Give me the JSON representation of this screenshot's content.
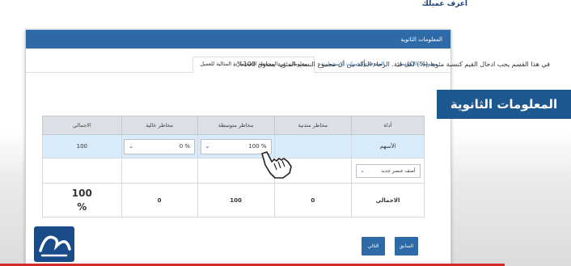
{
  "header": {
    "brand_link": "اعرف عميلك"
  },
  "panel": {
    "title": "المعلومات الثانوية",
    "tabs": [
      {
        "label": "معلومات الاستثمار",
        "active": false
      },
      {
        "label": "المعرفة والخبرات الاستثمارية",
        "active": false
      },
      {
        "label": "معلومات عن المحفظة الاستثمارية المثالية للعميل",
        "active": true
      }
    ],
    "instruction": "في هذا القسم يجب ادخال القيم كنسبة مئوية (%) لكل فئة. الرجاء التأكد من أن مجموع النسب المئوية يساوي 100% ."
  },
  "table": {
    "headers": [
      "أداة",
      "مخاطر متدنية",
      "مخاطر متوسطة",
      "مخاطر عالية",
      "الاجمالي"
    ],
    "stock_row": {
      "label": "الأسهم",
      "low": "",
      "medium": "100 %",
      "high": "0 %",
      "total": "100"
    },
    "add_row": {
      "select_placeholder": "أضف عنصر جديد"
    },
    "total_row": {
      "label": "الاجمالي",
      "low": "0",
      "medium": "100",
      "high": "0",
      "total_value": "100",
      "total_unit": "%"
    }
  },
  "overlay": {
    "section_label": "المعلومات الثانوية"
  },
  "buttons": {
    "prev": "السابق",
    "next": "التالي"
  },
  "icons": {
    "chevron": "chevron-down-icon",
    "cursor": "hand-pointer-icon",
    "logo": "site-logo"
  },
  "colors": {
    "primary": "#2f6aa8",
    "overlay": "#1e5891",
    "selected_row": "#d7ebfb",
    "accent_line": "#d32a2a"
  }
}
